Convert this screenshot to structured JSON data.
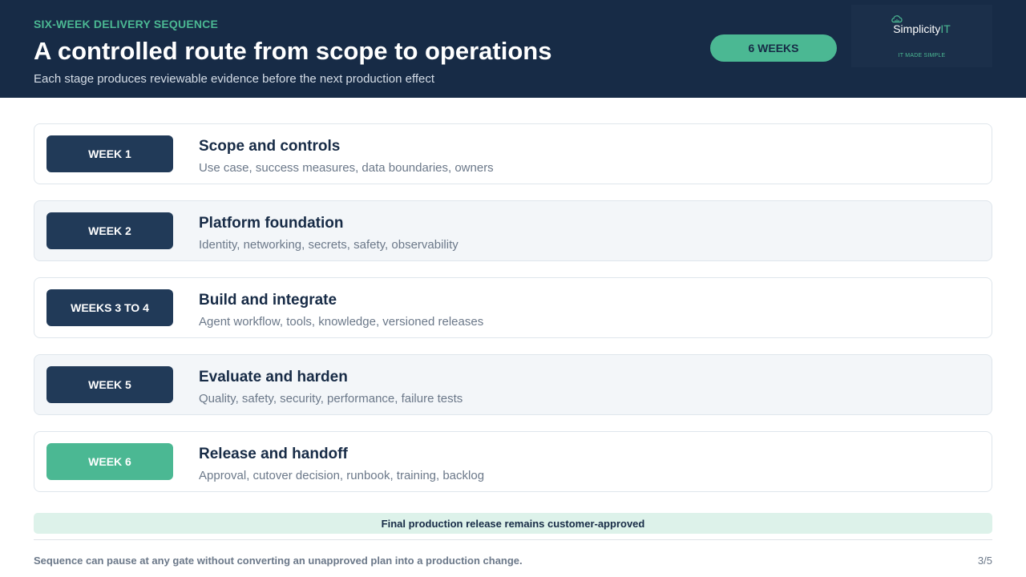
{
  "header": {
    "eyebrow": "SIX-WEEK DELIVERY SEQUENCE",
    "title": "A controlled route from scope to operations",
    "subtitle": "Each stage produces reviewable evidence before the next production effect",
    "duration_badge": "6 WEEKS"
  },
  "logo": {
    "icon": "cloud-icon",
    "name_primary": "Simplicity",
    "name_accent": "IT",
    "tagline": "IT MADE SIMPLE"
  },
  "stages": [
    {
      "week": "WEEK 1",
      "title": "Scope and controls",
      "description": "Use case, success measures, data boundaries, owners"
    },
    {
      "week": "WEEK 2",
      "title": "Platform foundation",
      "description": "Identity, networking, secrets, safety, observability"
    },
    {
      "week": "WEEKS 3 TO 4",
      "title": "Build and integrate",
      "description": "Agent workflow, tools, knowledge, versioned releases"
    },
    {
      "week": "WEEK 5",
      "title": "Evaluate and harden",
      "description": "Quality, safety, security, performance, failure tests"
    },
    {
      "week": "WEEK 6",
      "title": "Release and handoff",
      "description": "Approval, cutover decision, runbook, training, backlog"
    }
  ],
  "approval_banner": "Final production release remains customer-approved",
  "footer": {
    "note": "Sequence can pause at any gate without converting an unapproved plan into a production change.",
    "page_number": "3/5"
  },
  "colors": {
    "navy": "#172b46",
    "badge_navy": "#213a58",
    "accent_green": "#4bb893",
    "banner_mint": "#ddf2ea"
  }
}
